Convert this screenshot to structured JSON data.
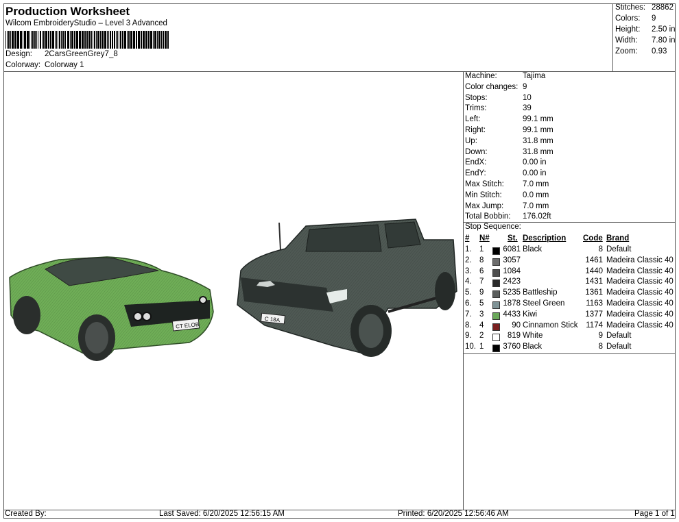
{
  "header": {
    "title": "Production Worksheet",
    "software": "Wilcom EmbroideryStudio – Level 3 Advanced",
    "design_label": "Design:",
    "design_value": "2CarsGreenGrey7_8",
    "colorway_label": "Colorway:",
    "colorway_value": "Colorway 1"
  },
  "stats": [
    {
      "label": "Stitches:",
      "value": "28862"
    },
    {
      "label": "Colors:",
      "value": "9"
    },
    {
      "label": "Height:",
      "value": "2.50 in"
    },
    {
      "label": "Width:",
      "value": "7.80 in"
    },
    {
      "label": "Zoom:",
      "value": "0.93"
    }
  ],
  "info": [
    {
      "label": "Machine:",
      "value": "Tajima"
    },
    {
      "label": "Color changes:",
      "value": "9"
    },
    {
      "label": "Stops:",
      "value": "10"
    },
    {
      "label": "Trims:",
      "value": "39"
    },
    {
      "label": "Left:",
      "value": "99.1 mm"
    },
    {
      "label": "Right:",
      "value": "99.1 mm"
    },
    {
      "label": "Up:",
      "value": "31.8 mm"
    },
    {
      "label": "Down:",
      "value": "31.8 mm"
    },
    {
      "label": "EndX:",
      "value": "0.00 in"
    },
    {
      "label": "EndY:",
      "value": "0.00 in"
    },
    {
      "label": "Max Stitch:",
      "value": "7.0 mm"
    },
    {
      "label": "Min Stitch:",
      "value": "0.0 mm"
    },
    {
      "label": "Max Jump:",
      "value": "7.0 mm"
    },
    {
      "label": "Total Bobbin:",
      "value": "176.02ft"
    }
  ],
  "stop_sequence": {
    "title": "Stop Sequence:",
    "headers": {
      "num": "#",
      "n": "N#",
      "st": "St.",
      "desc": "Description",
      "code": "Code",
      "brand": "Brand"
    },
    "rows": [
      {
        "num": "1.",
        "n": "1",
        "color": "#000000",
        "st": "6081",
        "desc": "Black",
        "code": "8",
        "brand": "Default"
      },
      {
        "num": "2.",
        "n": "8",
        "color": "#6d6d6d",
        "st": "3057",
        "desc": "",
        "code": "1461",
        "brand": "Madeira Classic 40"
      },
      {
        "num": "3.",
        "n": "6",
        "color": "#4f4f4f",
        "st": "1084",
        "desc": "",
        "code": "1440",
        "brand": "Madeira Classic 40"
      },
      {
        "num": "4.",
        "n": "7",
        "color": "#2b2b2b",
        "st": "2423",
        "desc": "",
        "code": "1431",
        "brand": "Madeira Classic 40"
      },
      {
        "num": "5.",
        "n": "9",
        "color": "#5a5d5c",
        "st": "5235",
        "desc": "Battleship",
        "code": "1361",
        "brand": "Madeira Classic 40"
      },
      {
        "num": "6.",
        "n": "5",
        "color": "#7f9396",
        "st": "1878",
        "desc": "Steel Green",
        "code": "1163",
        "brand": "Madeira Classic 40"
      },
      {
        "num": "7.",
        "n": "3",
        "color": "#6aa85a",
        "st": "4433",
        "desc": "Kiwi",
        "code": "1377",
        "brand": "Madeira Classic 40"
      },
      {
        "num": "8.",
        "n": "4",
        "color": "#7a2020",
        "st": "90",
        "desc": "Cinnamon Stick",
        "code": "1174",
        "brand": "Madeira Classic 40"
      },
      {
        "num": "9.",
        "n": "2",
        "color": "#ffffff",
        "st": "819",
        "desc": "White",
        "code": "9",
        "brand": "Default"
      },
      {
        "num": "10.",
        "n": "1",
        "color": "#000000",
        "st": "3760",
        "desc": "Black",
        "code": "8",
        "brand": "Default"
      }
    ]
  },
  "plates": {
    "left": "CT ELOB",
    "right": "C 18A"
  },
  "footer": {
    "created": "Created By:",
    "saved": "Last Saved: 6/20/2025 12:56:15 AM",
    "printed": "Printed: 6/20/2025 12:56:46 AM",
    "page": "Page 1 of 1"
  }
}
